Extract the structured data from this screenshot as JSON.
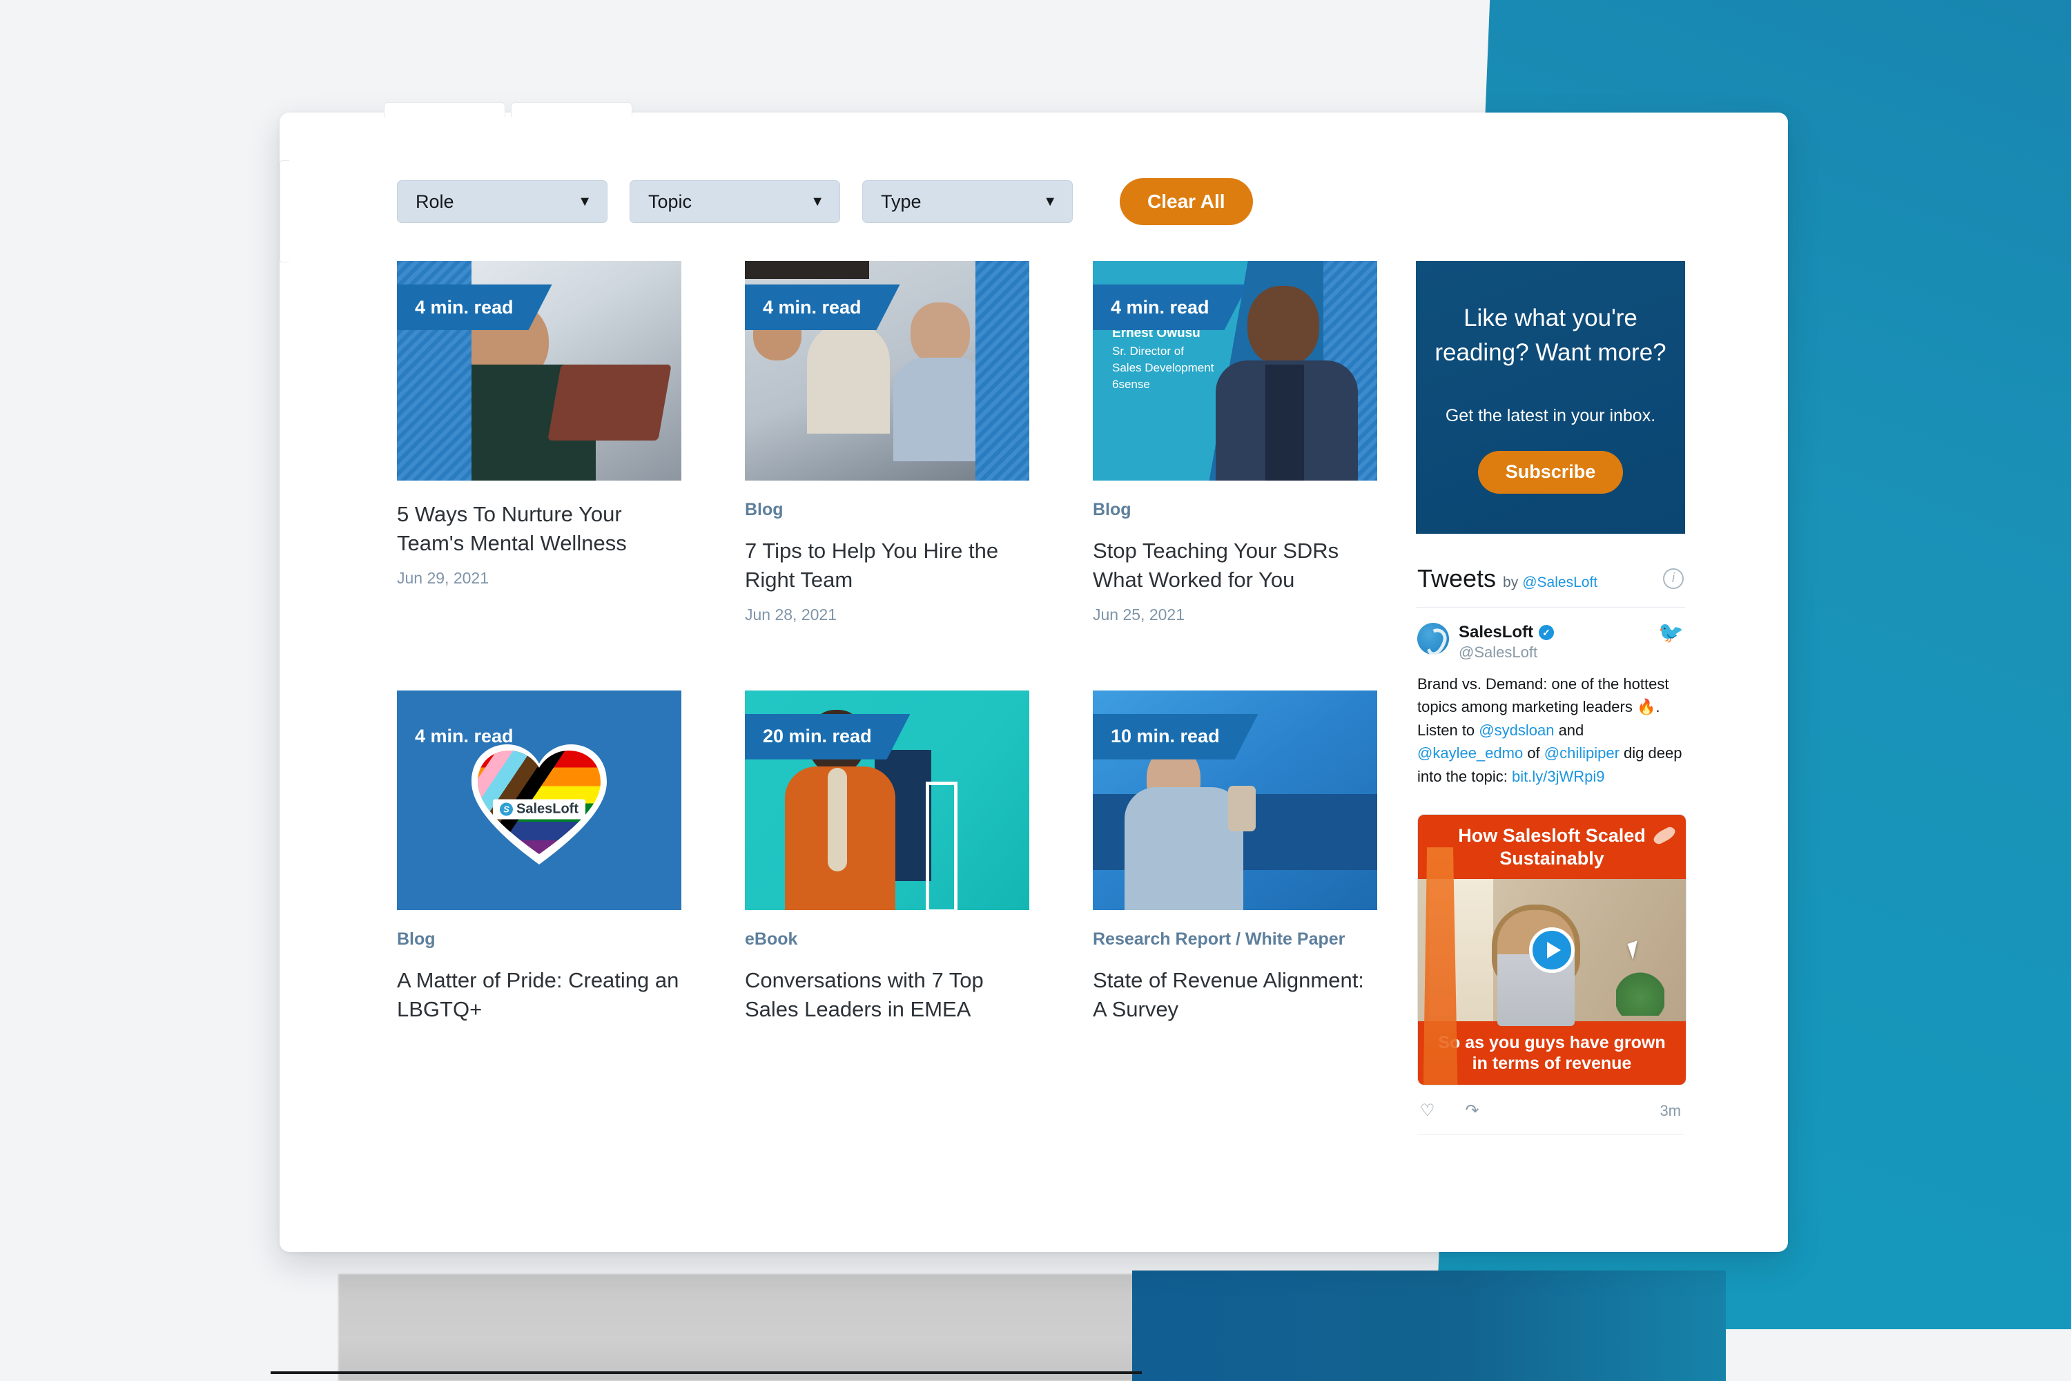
{
  "window": {
    "tabs": [
      "tab-1",
      "tab-2"
    ]
  },
  "filters": {
    "role": {
      "label": "Role",
      "caret": "chevron-down-icon"
    },
    "topic": {
      "label": "Topic",
      "caret": "chevron-down-icon"
    },
    "type": {
      "label": "Type",
      "caret": "chevron-down-icon"
    },
    "clear_all": "Clear All"
  },
  "cards": [
    {
      "read_time": "4 min. read",
      "kicker": "",
      "title": "5 Ways To Nurture Your Team's Mental Wellness",
      "date": "Jun 29, 2021"
    },
    {
      "read_time": "4 min. read",
      "kicker": "Blog",
      "title": "7 Tips to Help You Hire the Right Team",
      "date": "Jun 28, 2021"
    },
    {
      "read_time": "4 min. read",
      "kicker": "Blog",
      "title": "Stop Teaching Your SDRs What Worked for You",
      "date": "Jun 25, 2021",
      "speaker_name": "Ernest Owusu",
      "speaker_title": "Sr. Director of",
      "speaker_title2": "Sales Development",
      "speaker_company": "6sense"
    },
    {
      "read_time": "4 min. read",
      "kicker": "Blog",
      "title": "A Matter of Pride: Creating an LBGTQ+",
      "date": "",
      "logo_text": "SalesLoft"
    },
    {
      "read_time": "20 min. read",
      "kicker": "eBook",
      "title": "Conversations with 7 Top Sales Leaders in EMEA",
      "date": ""
    },
    {
      "read_time": "10 min. read",
      "kicker": "Research Report / White Paper",
      "title": "State of Revenue Alignment: A Survey",
      "date": ""
    }
  ],
  "subscribe": {
    "headline": "Like what you're reading? Want more?",
    "subtext": "Get the latest in your inbox.",
    "button": "Subscribe"
  },
  "tweets_widget": {
    "heading": "Tweets",
    "by_label": "by",
    "handle": "@SalesLoft",
    "info_icon": "info-icon",
    "tweet": {
      "display_name": "SalesLoft",
      "handle": "@SalesLoft",
      "verified_badge": "verified-icon",
      "bird_icon": "twitter-bird-icon",
      "text_part1": "Brand vs. Demand: one of the hottest topics among marketing leaders ",
      "emoji": "🔥",
      "text_part2": ". Listen to ",
      "mention1": "@sydsloan",
      "text_part3": " and ",
      "mention2": "@kaylee_edmo",
      "text_part4": " of ",
      "mention3": "@chilipiper",
      "text_part5": " dig deep into the topic: ",
      "link": "bit.ly/3jWRpi9"
    },
    "video": {
      "top_caption": "How Salesloft Scaled Sustainably",
      "bottom_caption": "So as you guys have grown in terms of revenue",
      "play_icon": "play-icon",
      "cursor_icon": "cursor-arrow-icon"
    },
    "actions": {
      "like_icon": "heart-icon",
      "share_icon": "share-icon",
      "timestamp": "3m"
    }
  },
  "colors": {
    "accent_orange": "#dd7d10",
    "brand_blue": "#1a6eb0",
    "deep_navy": "#0d4a77",
    "teal_bg": "#1a92b8",
    "twitter_blue": "#1b95e0",
    "kicker_blue": "#5d7f9c"
  }
}
